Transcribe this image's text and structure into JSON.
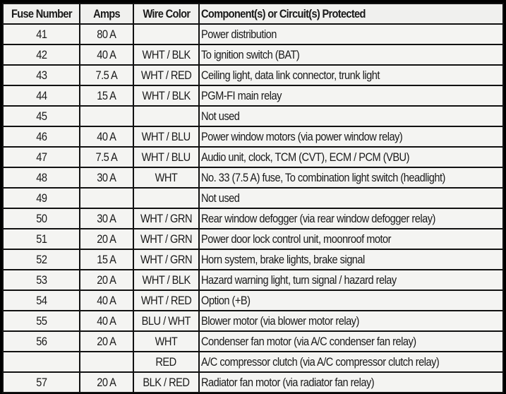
{
  "table": {
    "headers": [
      "Fuse Number",
      "Amps",
      "Wire Color",
      "Component(s) or Circuit(s) Protected"
    ],
    "rows": [
      {
        "fuse": "41",
        "amps": "80 A",
        "wire": "",
        "component": "Power distribution"
      },
      {
        "fuse": "42",
        "amps": "40 A",
        "wire": "WHT / BLK",
        "component": "To ignition switch (BAT)"
      },
      {
        "fuse": "43",
        "amps": "7.5 A",
        "wire": "WHT / RED",
        "component": "Ceiling light, data link connector, trunk light"
      },
      {
        "fuse": "44",
        "amps": "15 A",
        "wire": "WHT / BLK",
        "component": "PGM-FI main relay"
      },
      {
        "fuse": "45",
        "amps": "",
        "wire": "",
        "component": "Not used"
      },
      {
        "fuse": "46",
        "amps": "40 A",
        "wire": "WHT / BLU",
        "component": "Power window motors (via power window relay)"
      },
      {
        "fuse": "47",
        "amps": "7.5 A",
        "wire": "WHT / BLU",
        "component": "Audio unit, clock, TCM (CVT), ECM / PCM (VBU)"
      },
      {
        "fuse": "48",
        "amps": "30 A",
        "wire": "WHT",
        "component": "No. 33 (7.5 A) fuse, To combination light switch (headlight)"
      },
      {
        "fuse": "49",
        "amps": "",
        "wire": "",
        "component": "Not used"
      },
      {
        "fuse": "50",
        "amps": "30 A",
        "wire": "WHT / GRN",
        "component": "Rear window defogger (via rear window defogger relay)"
      },
      {
        "fuse": "51",
        "amps": "20 A",
        "wire": "WHT / GRN",
        "component": "Power door lock control unit, moonroof motor"
      },
      {
        "fuse": "52",
        "amps": "15 A",
        "wire": "WHT / GRN",
        "component": "Horn system, brake lights, brake signal"
      },
      {
        "fuse": "53",
        "amps": "20 A",
        "wire": "WHT / BLK",
        "component": "Hazard warning light, turn signal / hazard relay"
      },
      {
        "fuse": "54",
        "amps": "40 A",
        "wire": "WHT / RED",
        "component": "Option (+B)"
      },
      {
        "fuse": "55",
        "amps": "40 A",
        "wire": "BLU / WHT",
        "component": "Blower motor (via blower motor relay)"
      },
      {
        "fuse": "56",
        "amps": "20 A",
        "wire": "WHT",
        "component": "Condenser fan motor (via A/C condenser fan relay)"
      },
      {
        "fuse": "",
        "amps": "",
        "wire": "RED",
        "component": "A/C compressor clutch (via A/C compressor clutch relay)"
      },
      {
        "fuse": "57",
        "amps": "20 A",
        "wire": "BLK / RED",
        "component": "Radiator fan motor (via radiator fan relay)"
      }
    ]
  }
}
